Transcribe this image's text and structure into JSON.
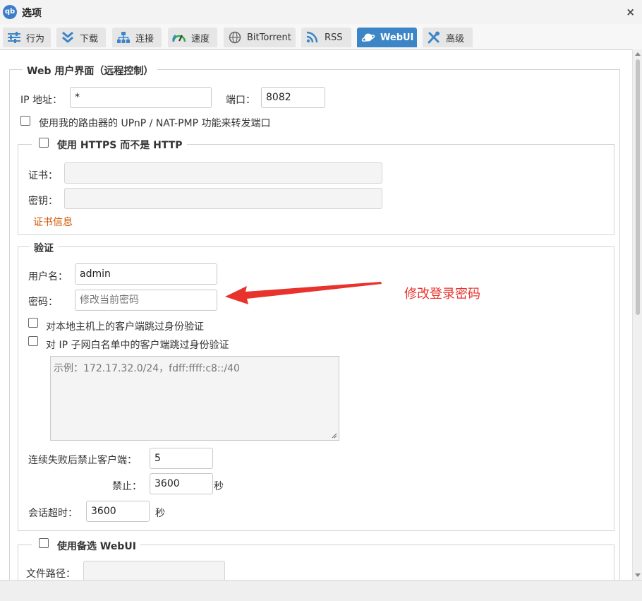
{
  "window": {
    "app_icon_text": "qb",
    "title": "选项",
    "close_glyph": "×"
  },
  "tabs": [
    {
      "label": "行为",
      "icon": "sliders-icon"
    },
    {
      "label": "下载",
      "icon": "download-chevrons-icon"
    },
    {
      "label": "连接",
      "icon": "network-icon"
    },
    {
      "label": "速度",
      "icon": "speedometer-icon"
    },
    {
      "label": "BitTorrent",
      "icon": "globe-icon"
    },
    {
      "label": "RSS",
      "icon": "rss-icon"
    },
    {
      "label": "WebUI",
      "icon": "webui-planet-icon",
      "active": true
    },
    {
      "label": "高级",
      "icon": "tools-icon"
    }
  ],
  "webui": {
    "legend": "Web 用户界面（远程控制）",
    "ip_label": "IP 地址：",
    "ip_value": "*",
    "port_label": "端口：",
    "port_value": "8082",
    "upnp_label": "使用我的路由器的 UPnP / NAT-PMP 功能来转发端口",
    "upnp_checked": false
  },
  "https": {
    "legend": "使用 HTTPS 而不是 HTTP",
    "checked": false,
    "cert_label": "证书：",
    "cert_value": "",
    "key_label": "密钥：",
    "key_value": "",
    "cert_info_link": "证书信息"
  },
  "auth": {
    "legend": "验证",
    "username_label": "用户名：",
    "username_value": "admin",
    "password_label": "密码：",
    "password_placeholder": "修改当前密码",
    "bypass_local_label": "对本地主机上的客户端跳过身份验证",
    "bypass_local_checked": false,
    "bypass_subnet_label": "对 IP 子网白名单中的客户端跳过身份验证",
    "bypass_subnet_checked": false,
    "subnet_placeholder": "示例：172.17.32.0/24，fdff:ffff:c8::/40",
    "max_fail_label": "连续失败后禁止客户端：",
    "max_fail_value": "5",
    "ban_label": "禁止：",
    "ban_value": "3600",
    "ban_unit": "秒",
    "session_label": "会话超时：",
    "session_value": "3600",
    "session_unit": "秒"
  },
  "alt_webui": {
    "legend": "使用备选 WebUI",
    "checked": false,
    "path_label": "文件路径：",
    "path_value": ""
  },
  "annotation": {
    "text": "修改登录密码",
    "color": "#e8332d"
  },
  "colors": {
    "active_tab": "#3c86c7",
    "link": "#d35400"
  }
}
